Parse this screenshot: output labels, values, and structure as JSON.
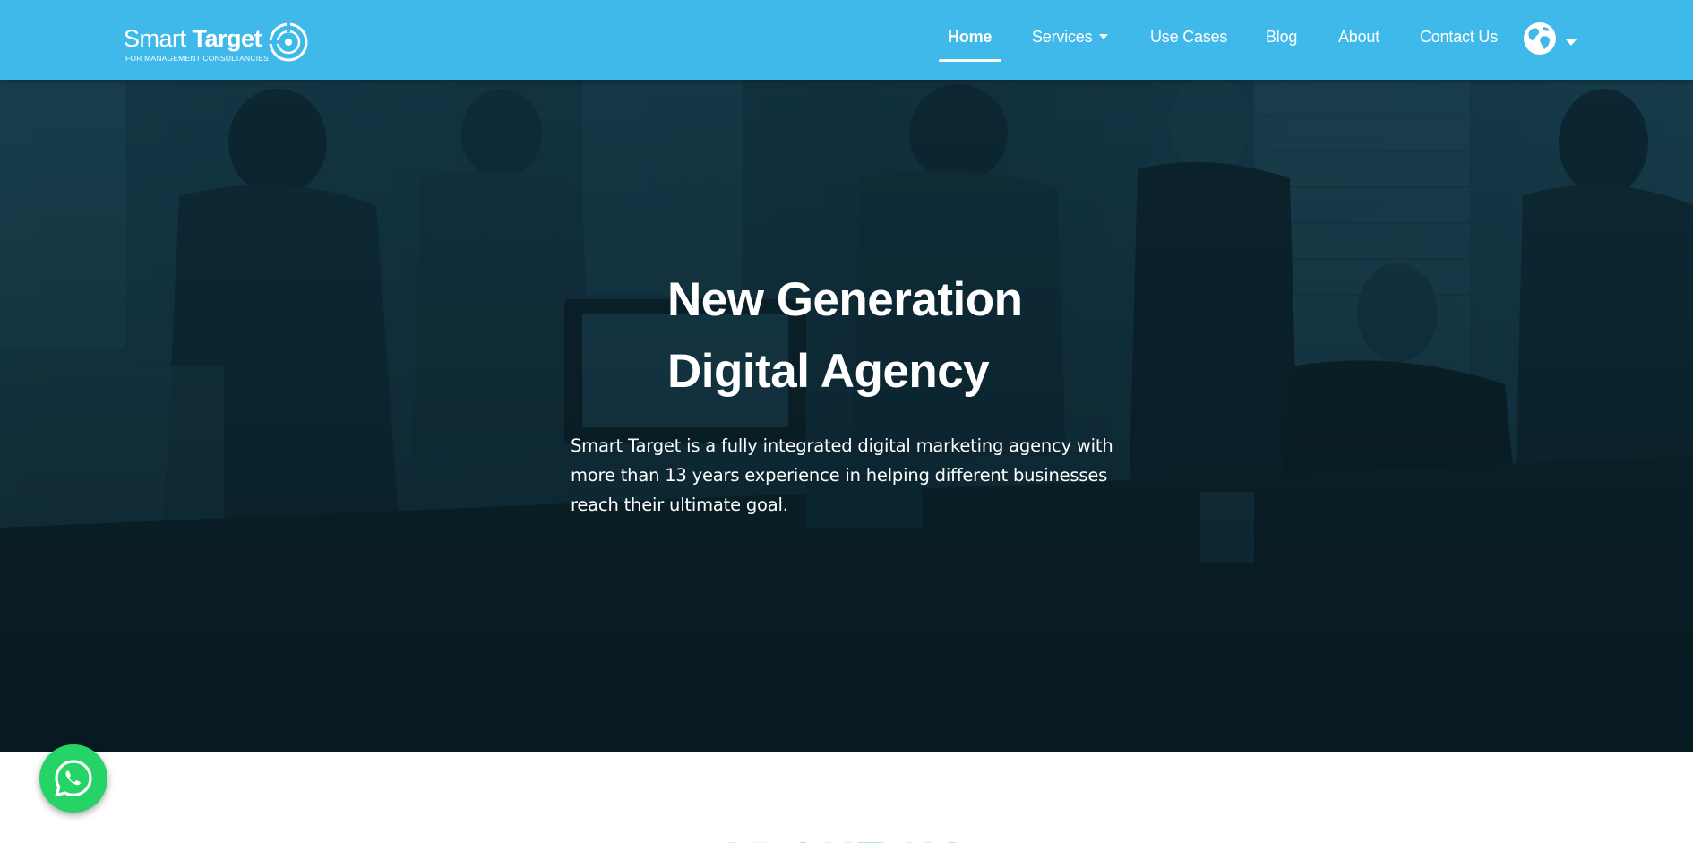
{
  "brand": {
    "name_light": "Smart",
    "name_bold": "Target",
    "tagline": "FOR MANAGEMENT CONSULTANCIES"
  },
  "nav": {
    "items": [
      {
        "label": "Home",
        "active": true
      },
      {
        "label": "Services",
        "dropdown": true
      },
      {
        "label": "Use Cases"
      },
      {
        "label": "Blog"
      },
      {
        "label": "About"
      },
      {
        "label": "Contact Us"
      }
    ],
    "language_icon": "globe-icon"
  },
  "hero": {
    "title_line1": "New Generation",
    "title_line2": "Digital Agency",
    "description": "Smart Target is a fully integrated digital marketing agency with more than 13 years experience in helping different businesses reach their ultimate goal."
  },
  "next_section": {
    "heading": "ABOUT US"
  },
  "floating": {
    "whatsapp_icon": "whatsapp-icon"
  },
  "colors": {
    "brand_blue": "#3fb9ea",
    "hero_overlay": "#12303d",
    "whatsapp_green": "#25d366",
    "text_white": "#ffffff"
  }
}
